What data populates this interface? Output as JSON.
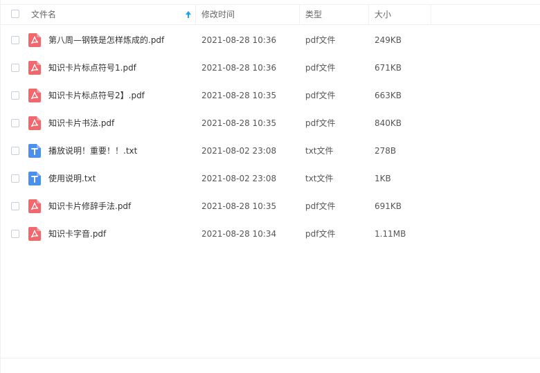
{
  "header": {
    "name_label": "文件名",
    "modified_label": "修改时间",
    "type_label": "类型",
    "size_label": "大小",
    "sort_icon": "arrow-up-icon"
  },
  "icons": {
    "pdf": "pdf-file-icon",
    "txt": "txt-file-icon"
  },
  "colors": {
    "pdf": "#f0686e",
    "txt": "#4a90ec",
    "sort_arrow": "#1e9ff2"
  },
  "files": [
    {
      "name": "第八周—钢铁是怎样炼成的.pdf",
      "modified": "2021-08-28 10:36",
      "type": "pdf文件",
      "size": "249KB",
      "kind": "pdf"
    },
    {
      "name": "知识卡片标点符号1.pdf",
      "modified": "2021-08-28 10:36",
      "type": "pdf文件",
      "size": "671KB",
      "kind": "pdf"
    },
    {
      "name": "知识卡片标点符号2】.pdf",
      "modified": "2021-08-28 10:35",
      "type": "pdf文件",
      "size": "663KB",
      "kind": "pdf"
    },
    {
      "name": "知识卡片书法.pdf",
      "modified": "2021-08-28 10:35",
      "type": "pdf文件",
      "size": "840KB",
      "kind": "pdf"
    },
    {
      "name": "播放说明！重要！！.txt",
      "modified": "2021-08-02 23:08",
      "type": "txt文件",
      "size": "278B",
      "kind": "txt"
    },
    {
      "name": "使用说明.txt",
      "modified": "2021-08-02 23:08",
      "type": "txt文件",
      "size": "1KB",
      "kind": "txt"
    },
    {
      "name": "知识卡片修辞手法.pdf",
      "modified": "2021-08-28 10:35",
      "type": "pdf文件",
      "size": "691KB",
      "kind": "pdf"
    },
    {
      "name": "知识卡字音.pdf",
      "modified": "2021-08-28 10:34",
      "type": "pdf文件",
      "size": "1.11MB",
      "kind": "pdf"
    }
  ]
}
